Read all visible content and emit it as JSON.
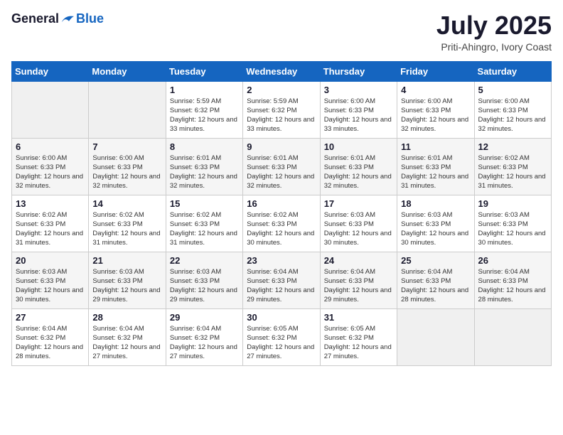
{
  "header": {
    "logo_general": "General",
    "logo_blue": "Blue",
    "month_year": "July 2025",
    "location": "Priti-Ahingro, Ivory Coast"
  },
  "calendar": {
    "days_of_week": [
      "Sunday",
      "Monday",
      "Tuesday",
      "Wednesday",
      "Thursday",
      "Friday",
      "Saturday"
    ],
    "weeks": [
      [
        {
          "day": "",
          "info": ""
        },
        {
          "day": "",
          "info": ""
        },
        {
          "day": "1",
          "info": "Sunrise: 5:59 AM\nSunset: 6:32 PM\nDaylight: 12 hours and 33 minutes."
        },
        {
          "day": "2",
          "info": "Sunrise: 5:59 AM\nSunset: 6:32 PM\nDaylight: 12 hours and 33 minutes."
        },
        {
          "day": "3",
          "info": "Sunrise: 6:00 AM\nSunset: 6:33 PM\nDaylight: 12 hours and 33 minutes."
        },
        {
          "day": "4",
          "info": "Sunrise: 6:00 AM\nSunset: 6:33 PM\nDaylight: 12 hours and 32 minutes."
        },
        {
          "day": "5",
          "info": "Sunrise: 6:00 AM\nSunset: 6:33 PM\nDaylight: 12 hours and 32 minutes."
        }
      ],
      [
        {
          "day": "6",
          "info": "Sunrise: 6:00 AM\nSunset: 6:33 PM\nDaylight: 12 hours and 32 minutes."
        },
        {
          "day": "7",
          "info": "Sunrise: 6:00 AM\nSunset: 6:33 PM\nDaylight: 12 hours and 32 minutes."
        },
        {
          "day": "8",
          "info": "Sunrise: 6:01 AM\nSunset: 6:33 PM\nDaylight: 12 hours and 32 minutes."
        },
        {
          "day": "9",
          "info": "Sunrise: 6:01 AM\nSunset: 6:33 PM\nDaylight: 12 hours and 32 minutes."
        },
        {
          "day": "10",
          "info": "Sunrise: 6:01 AM\nSunset: 6:33 PM\nDaylight: 12 hours and 32 minutes."
        },
        {
          "day": "11",
          "info": "Sunrise: 6:01 AM\nSunset: 6:33 PM\nDaylight: 12 hours and 31 minutes."
        },
        {
          "day": "12",
          "info": "Sunrise: 6:02 AM\nSunset: 6:33 PM\nDaylight: 12 hours and 31 minutes."
        }
      ],
      [
        {
          "day": "13",
          "info": "Sunrise: 6:02 AM\nSunset: 6:33 PM\nDaylight: 12 hours and 31 minutes."
        },
        {
          "day": "14",
          "info": "Sunrise: 6:02 AM\nSunset: 6:33 PM\nDaylight: 12 hours and 31 minutes."
        },
        {
          "day": "15",
          "info": "Sunrise: 6:02 AM\nSunset: 6:33 PM\nDaylight: 12 hours and 31 minutes."
        },
        {
          "day": "16",
          "info": "Sunrise: 6:02 AM\nSunset: 6:33 PM\nDaylight: 12 hours and 30 minutes."
        },
        {
          "day": "17",
          "info": "Sunrise: 6:03 AM\nSunset: 6:33 PM\nDaylight: 12 hours and 30 minutes."
        },
        {
          "day": "18",
          "info": "Sunrise: 6:03 AM\nSunset: 6:33 PM\nDaylight: 12 hours and 30 minutes."
        },
        {
          "day": "19",
          "info": "Sunrise: 6:03 AM\nSunset: 6:33 PM\nDaylight: 12 hours and 30 minutes."
        }
      ],
      [
        {
          "day": "20",
          "info": "Sunrise: 6:03 AM\nSunset: 6:33 PM\nDaylight: 12 hours and 30 minutes."
        },
        {
          "day": "21",
          "info": "Sunrise: 6:03 AM\nSunset: 6:33 PM\nDaylight: 12 hours and 29 minutes."
        },
        {
          "day": "22",
          "info": "Sunrise: 6:03 AM\nSunset: 6:33 PM\nDaylight: 12 hours and 29 minutes."
        },
        {
          "day": "23",
          "info": "Sunrise: 6:04 AM\nSunset: 6:33 PM\nDaylight: 12 hours and 29 minutes."
        },
        {
          "day": "24",
          "info": "Sunrise: 6:04 AM\nSunset: 6:33 PM\nDaylight: 12 hours and 29 minutes."
        },
        {
          "day": "25",
          "info": "Sunrise: 6:04 AM\nSunset: 6:33 PM\nDaylight: 12 hours and 28 minutes."
        },
        {
          "day": "26",
          "info": "Sunrise: 6:04 AM\nSunset: 6:33 PM\nDaylight: 12 hours and 28 minutes."
        }
      ],
      [
        {
          "day": "27",
          "info": "Sunrise: 6:04 AM\nSunset: 6:32 PM\nDaylight: 12 hours and 28 minutes."
        },
        {
          "day": "28",
          "info": "Sunrise: 6:04 AM\nSunset: 6:32 PM\nDaylight: 12 hours and 27 minutes."
        },
        {
          "day": "29",
          "info": "Sunrise: 6:04 AM\nSunset: 6:32 PM\nDaylight: 12 hours and 27 minutes."
        },
        {
          "day": "30",
          "info": "Sunrise: 6:05 AM\nSunset: 6:32 PM\nDaylight: 12 hours and 27 minutes."
        },
        {
          "day": "31",
          "info": "Sunrise: 6:05 AM\nSunset: 6:32 PM\nDaylight: 12 hours and 27 minutes."
        },
        {
          "day": "",
          "info": ""
        },
        {
          "day": "",
          "info": ""
        }
      ]
    ]
  }
}
